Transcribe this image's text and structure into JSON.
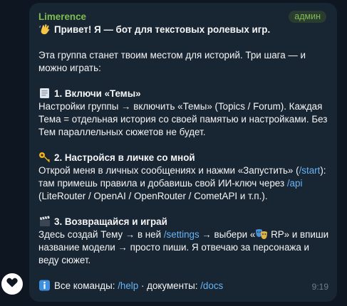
{
  "message": {
    "sender": "Limerence",
    "badge": "админ",
    "time": "9:19",
    "greeting": "Привет! Я — бот для текстовых ролевых игр.",
    "intro_1": "Эта группа станет твоим местом для историй. Три шага — и",
    "intro_2": "можно играть:",
    "step1": {
      "title": "1. Включи «Темы»",
      "line1": "Настройки группы → включить «Темы» (Topics / Forum). Каждая",
      "line2": "Тема = отдельная история со своей памятью и настройками. Без",
      "line3": "Тем параллельных сюжетов не будет."
    },
    "step2": {
      "title": "2. Настройся в личке со мной",
      "line1_a": "Открой меня в личных сообщениях и нажми «Запустить» (",
      "line1_link": "/start",
      "line1_b": "):",
      "line2_a": "там примешь правила и добавишь свой ИИ-ключ через ",
      "line2_link": "/api",
      "line3": "(LiteRouter / OpenAI / OpenRouter / CometAPI и т.п.)."
    },
    "step3": {
      "title": "3. Возвращайся и играй",
      "line1_a": "Здесь создай Тему → в ней ",
      "line1_link": "/settings",
      "line1_b": " → выбери «",
      "line1_c": " RP» и впиши",
      "line2": "название модели → просто пиши. Я отвечаю за персонажа и",
      "line3": "веду сюжет."
    },
    "footer": {
      "prefix": "Все команды: ",
      "help_link": "/help",
      "middle": " · документы: ",
      "docs_link": "/docs"
    }
  },
  "icons": {
    "greeting": "waving-hand-icon",
    "step1": "page-facing-up-icon",
    "step2": "key-icon",
    "step3": "clapper-board-icon",
    "step3_inline": "performing-arts-icon",
    "footer": "information-icon",
    "reaction": "heart-icon"
  },
  "colors": {
    "background": "#0e1621",
    "bubble": "#182533",
    "sender": "#7fbd4f",
    "link": "#6ab3f3",
    "time": "#6d7f8f"
  }
}
